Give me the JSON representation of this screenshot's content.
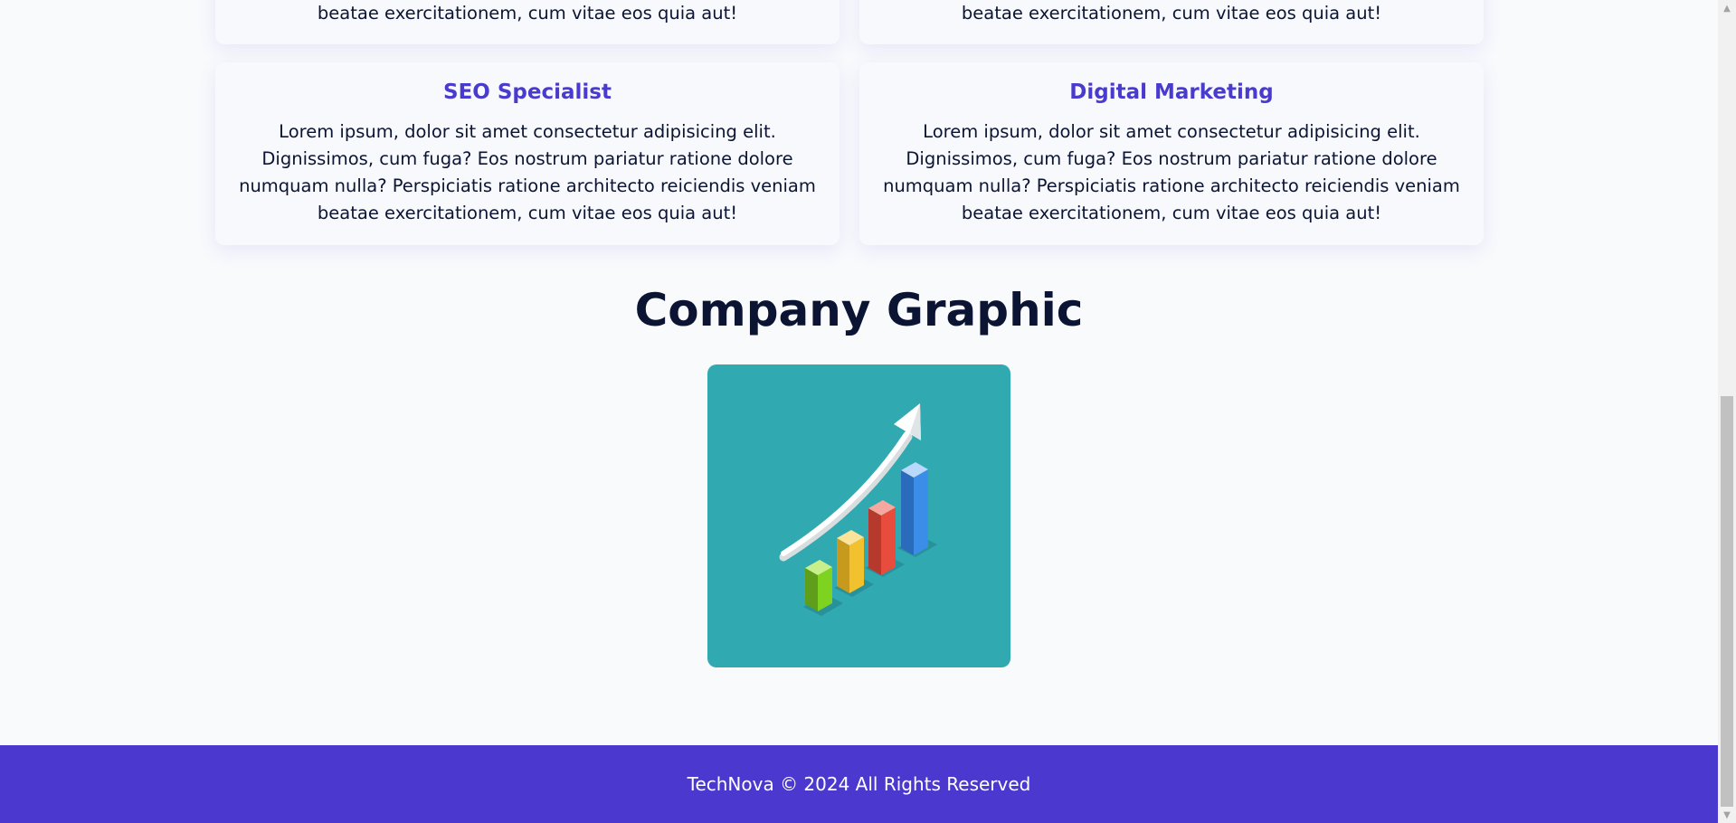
{
  "services": {
    "top_cards": [
      {
        "text": "beatae exercitationem, cum vitae eos quia aut!"
      },
      {
        "text": "beatae exercitationem, cum vitae eos quia aut!"
      }
    ],
    "cards": [
      {
        "title": "SEO Specialist",
        "text": "Lorem ipsum, dolor sit amet consectetur adipisicing elit. Dignissimos, cum fuga? Eos nostrum pariatur ratione dolore numquam nulla? Perspiciatis ratione architecto reiciendis veniam beatae exercitationem, cum vitae eos quia aut!"
      },
      {
        "title": "Digital Marketing",
        "text": "Lorem ipsum, dolor sit amet consectetur adipisicing elit. Dignissimos, cum fuga? Eos nostrum pariatur ratione dolore numquam nulla? Perspiciatis ratione architecto reiciendis veniam beatae exercitationem, cum vitae eos quia aut!"
      }
    ]
  },
  "graphic_section": {
    "title": "Company Graphic",
    "image_icon": "growth-bar-chart-arrow-icon",
    "image_colors": {
      "background": "#31a9b0",
      "bar1": "#7ed321",
      "bar2": "#f2c12e",
      "bar3": "#e74c3c",
      "bar4": "#3b8ee8",
      "arrow": "#ffffff"
    }
  },
  "footer": {
    "text": "TechNova © 2024 All Rights Reserved",
    "color": "#4b38cf"
  },
  "colors": {
    "accent": "#4a3bcf",
    "page_bg": "#f8fafc",
    "heading": "#0b1533"
  }
}
